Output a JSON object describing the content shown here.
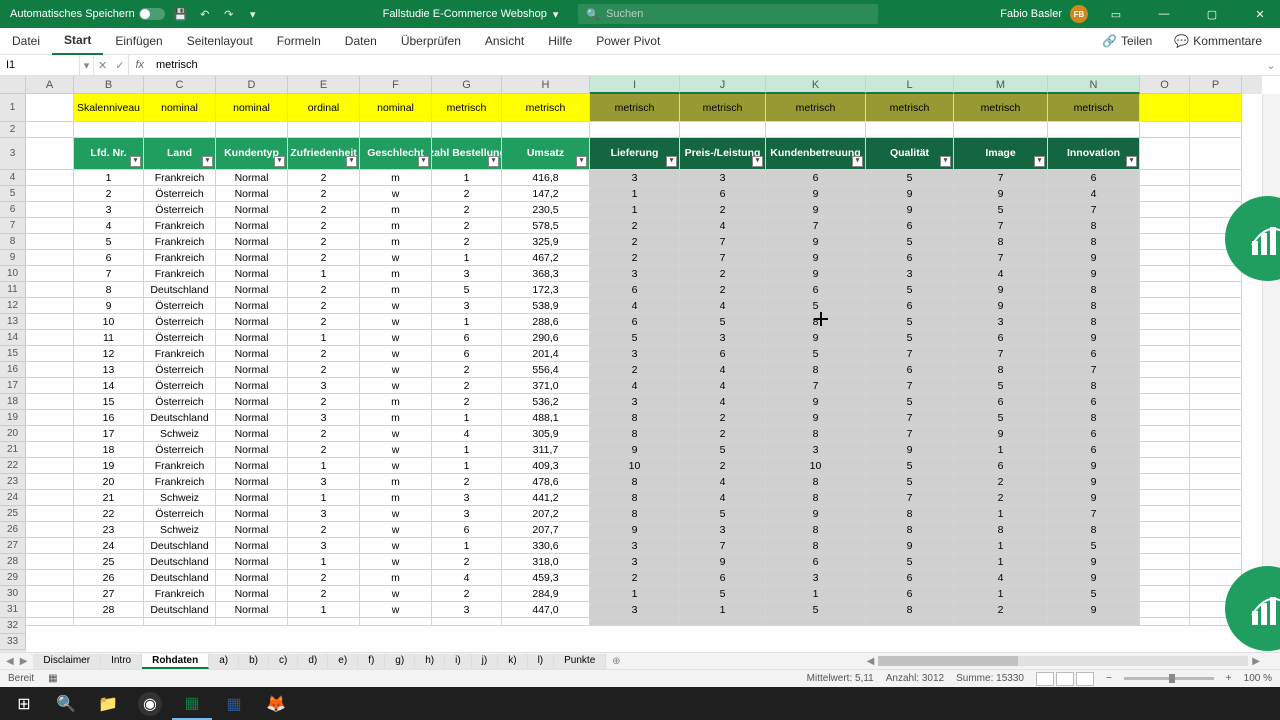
{
  "titlebar": {
    "autosave": "Automatisches Speichern",
    "filename": "Fallstudie E-Commerce Webshop",
    "search_placeholder": "Suchen",
    "user_name": "Fabio Basler",
    "user_initials": "FB"
  },
  "ribbon": {
    "tabs": [
      "Datei",
      "Start",
      "Einfügen",
      "Seitenlayout",
      "Formeln",
      "Daten",
      "Überprüfen",
      "Ansicht",
      "Hilfe",
      "Power Pivot"
    ],
    "share": "Teilen",
    "comments": "Kommentare"
  },
  "formula_bar": {
    "name_box": "I1",
    "value": "metrisch"
  },
  "columns": [
    "A",
    "B",
    "C",
    "D",
    "E",
    "F",
    "G",
    "H",
    "I",
    "J",
    "K",
    "L",
    "M",
    "N",
    "O",
    "P"
  ],
  "selected_cols": [
    "I",
    "J",
    "K",
    "L",
    "M",
    "N"
  ],
  "scale_row": {
    "label": "Skalenniveau",
    "values": [
      "nominal",
      "nominal",
      "ordinal",
      "nominal",
      "metrisch",
      "metrisch",
      "metrisch",
      "metrisch",
      "metrisch",
      "metrisch",
      "metrisch",
      "metrisch"
    ]
  },
  "table_headers": [
    "Lfd. Nr.",
    "Land",
    "Kundentyp",
    "Zufriedenheit",
    "Geschlecht",
    "Anzahl Bestellungen",
    "Umsatz",
    "Lieferung",
    "Preis-/Leistung",
    "Kundenbetreuung",
    "Qualität",
    "Image",
    "Innovation"
  ],
  "rows": [
    [
      1,
      "Frankreich",
      "Normal",
      2,
      "m",
      1,
      "416,8",
      3,
      3,
      6,
      5,
      7,
      6
    ],
    [
      2,
      "Österreich",
      "Normal",
      2,
      "w",
      2,
      "147,2",
      1,
      6,
      9,
      9,
      9,
      4
    ],
    [
      3,
      "Österreich",
      "Normal",
      2,
      "m",
      2,
      "230,5",
      1,
      2,
      9,
      9,
      5,
      7
    ],
    [
      4,
      "Frankreich",
      "Normal",
      2,
      "m",
      2,
      "578,5",
      2,
      4,
      7,
      6,
      7,
      8
    ],
    [
      5,
      "Frankreich",
      "Normal",
      2,
      "m",
      2,
      "325,9",
      2,
      7,
      9,
      5,
      8,
      8
    ],
    [
      6,
      "Frankreich",
      "Normal",
      2,
      "w",
      1,
      "467,2",
      2,
      7,
      9,
      6,
      7,
      9
    ],
    [
      7,
      "Frankreich",
      "Normal",
      1,
      "m",
      3,
      "368,3",
      3,
      2,
      9,
      3,
      4,
      9
    ],
    [
      8,
      "Deutschland",
      "Normal",
      2,
      "m",
      5,
      "172,3",
      6,
      2,
      6,
      5,
      9,
      8
    ],
    [
      9,
      "Österreich",
      "Normal",
      2,
      "w",
      3,
      "538,9",
      4,
      4,
      5,
      6,
      9,
      8
    ],
    [
      10,
      "Österreich",
      "Normal",
      2,
      "w",
      1,
      "288,6",
      6,
      5,
      8,
      5,
      3,
      8
    ],
    [
      11,
      "Österreich",
      "Normal",
      1,
      "w",
      6,
      "290,6",
      5,
      3,
      9,
      5,
      6,
      9
    ],
    [
      12,
      "Frankreich",
      "Normal",
      2,
      "w",
      6,
      "201,4",
      3,
      6,
      5,
      7,
      7,
      6
    ],
    [
      13,
      "Österreich",
      "Normal",
      2,
      "w",
      2,
      "556,4",
      2,
      4,
      8,
      6,
      8,
      7
    ],
    [
      14,
      "Österreich",
      "Normal",
      3,
      "w",
      2,
      "371,0",
      4,
      4,
      7,
      7,
      5,
      8
    ],
    [
      15,
      "Österreich",
      "Normal",
      2,
      "m",
      2,
      "536,2",
      3,
      4,
      9,
      5,
      6,
      6
    ],
    [
      16,
      "Deutschland",
      "Normal",
      3,
      "m",
      1,
      "488,1",
      8,
      2,
      9,
      7,
      5,
      8
    ],
    [
      17,
      "Schweiz",
      "Normal",
      2,
      "w",
      4,
      "305,9",
      8,
      2,
      8,
      7,
      9,
      6
    ],
    [
      18,
      "Österreich",
      "Normal",
      2,
      "w",
      1,
      "311,7",
      9,
      5,
      3,
      9,
      1,
      6
    ],
    [
      19,
      "Frankreich",
      "Normal",
      1,
      "w",
      1,
      "409,3",
      10,
      2,
      10,
      5,
      6,
      9
    ],
    [
      20,
      "Frankreich",
      "Normal",
      3,
      "m",
      2,
      "478,6",
      8,
      4,
      8,
      5,
      2,
      9
    ],
    [
      21,
      "Schweiz",
      "Normal",
      1,
      "m",
      3,
      "441,2",
      8,
      4,
      8,
      7,
      2,
      9
    ],
    [
      22,
      "Österreich",
      "Normal",
      3,
      "w",
      3,
      "207,2",
      8,
      5,
      9,
      8,
      1,
      7
    ],
    [
      23,
      "Schweiz",
      "Normal",
      2,
      "w",
      6,
      "207,7",
      9,
      3,
      8,
      8,
      8,
      8
    ],
    [
      24,
      "Deutschland",
      "Normal",
      3,
      "w",
      1,
      "330,6",
      3,
      7,
      8,
      9,
      1,
      5
    ],
    [
      25,
      "Deutschland",
      "Normal",
      1,
      "w",
      2,
      "318,0",
      3,
      9,
      6,
      5,
      1,
      9
    ],
    [
      26,
      "Deutschland",
      "Normal",
      2,
      "m",
      4,
      "459,3",
      2,
      6,
      3,
      6,
      4,
      9
    ],
    [
      27,
      "Frankreich",
      "Normal",
      2,
      "w",
      2,
      "284,9",
      1,
      5,
      1,
      6,
      1,
      5
    ],
    [
      28,
      "Deutschland",
      "Normal",
      1,
      "w",
      3,
      "447,0",
      3,
      1,
      5,
      8,
      2,
      9
    ]
  ],
  "sheet_tabs": [
    "Disclaimer",
    "Intro",
    "Rohdaten",
    "a)",
    "b)",
    "c)",
    "d)",
    "e)",
    "f)",
    "g)",
    "h)",
    "i)",
    "j)",
    "k)",
    "l)",
    "Punkte"
  ],
  "active_sheet": "Rohdaten",
  "status": {
    "ready": "Bereit",
    "avg_label": "Mittelwert:",
    "avg": "5,11",
    "count_label": "Anzahl:",
    "count": "3012",
    "sum_label": "Summe:",
    "sum": "15330",
    "zoom": "100 %"
  }
}
